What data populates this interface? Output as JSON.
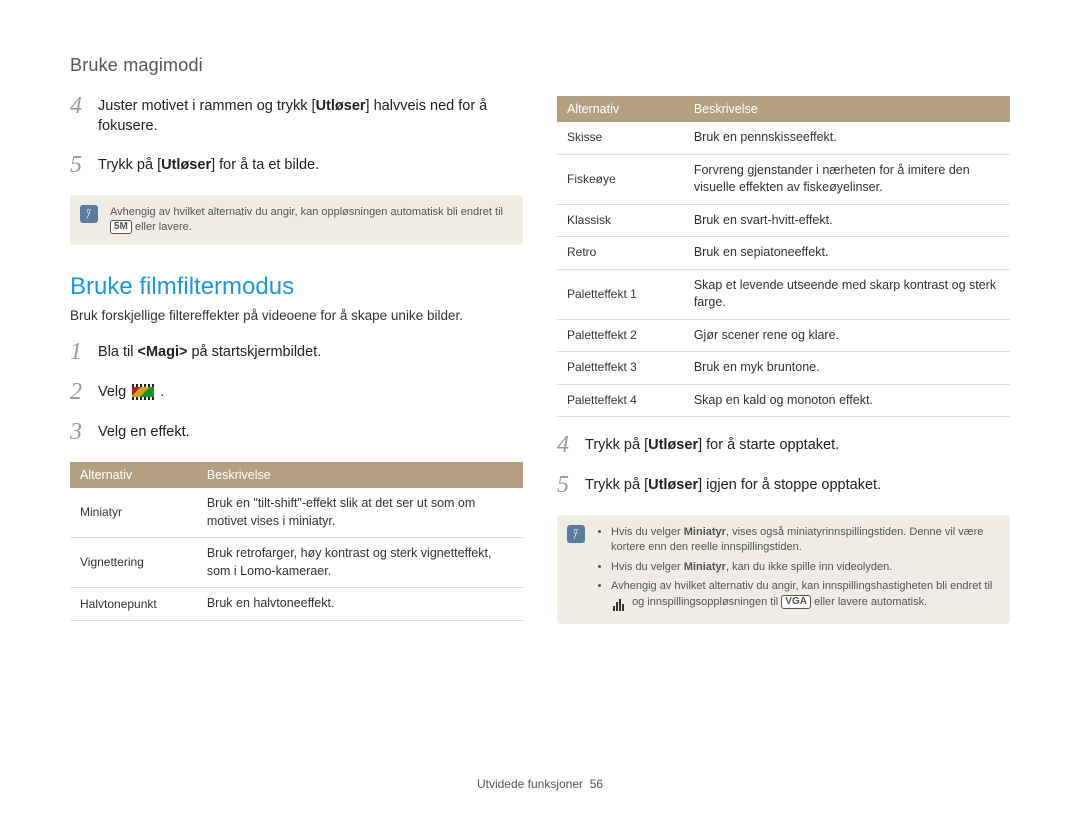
{
  "header": {
    "title": "Bruke magimodi"
  },
  "left": {
    "step4": {
      "num": "4",
      "pre": "Juster motivet i rammen og trykk [",
      "bold": "Utløser",
      "post": "] halvveis ned for å fokusere."
    },
    "step5": {
      "num": "5",
      "pre": "Trykk på [",
      "bold": "Utløser",
      "post": "] for å ta et bilde."
    },
    "note1": {
      "text_pre": "Avhengig av hvilket alternativ du angir, kan oppløsningen automatisk bli endret til ",
      "pill": "5M",
      "text_post": " eller lavere."
    },
    "heading": "Bruke filmfiltermodus",
    "subheading": "Bruk forskjellige filtereffekter på videoene for å skape unike bilder.",
    "step1": {
      "num": "1",
      "pre": "Bla til ",
      "bold": "<Magi>",
      "post": " på startskjermbildet."
    },
    "step2": {
      "num": "2",
      "text": "Velg",
      "post": " ."
    },
    "step3": {
      "num": "3",
      "text": "Velg en effekt."
    },
    "tableHeaders": {
      "opt": "Alternativ",
      "desc": "Beskrivelse"
    },
    "rows": [
      {
        "opt": "Miniatyr",
        "desc": "Bruk en \"tilt-shift\"-effekt slik at det ser ut som om motivet vises i miniatyr."
      },
      {
        "opt": "Vignettering",
        "desc": "Bruk retrofarger, høy kontrast og sterk vignetteffekt, som i Lomo-kameraer."
      },
      {
        "opt": "Halvtonepunkt",
        "desc": "Bruk en halvtoneeffekt."
      }
    ]
  },
  "right": {
    "tableHeaders": {
      "opt": "Alternativ",
      "desc": "Beskrivelse"
    },
    "rows": [
      {
        "opt": "Skisse",
        "desc": "Bruk en pennskisseeffekt."
      },
      {
        "opt": "Fiskeøye",
        "desc": "Forvreng gjenstander i nærheten for å imitere den visuelle effekten av fiskeøyelinser."
      },
      {
        "opt": "Klassisk",
        "desc": "Bruk en svart-hvitt-effekt."
      },
      {
        "opt": "Retro",
        "desc": "Bruk en sepiatoneeffekt."
      },
      {
        "opt": "Paletteffekt 1",
        "desc": "Skap et levende utseende med skarp kontrast og sterk farge."
      },
      {
        "opt": "Paletteffekt 2",
        "desc": "Gjør scener rene og klare."
      },
      {
        "opt": "Paletteffekt 3",
        "desc": "Bruk en myk bruntone."
      },
      {
        "opt": "Paletteffekt 4",
        "desc": "Skap en kald og monoton effekt."
      }
    ],
    "step4": {
      "num": "4",
      "pre": "Trykk på [",
      "bold": "Utløser",
      "post": "] for å starte opptaket."
    },
    "step5": {
      "num": "5",
      "pre": "Trykk på [",
      "bold": "Utløser",
      "post": "] igjen for å stoppe opptaket."
    },
    "note2": {
      "li1_pre": "Hvis du velger ",
      "li1_bold": "Miniatyr",
      "li1_post": ", vises også miniatyrinnspillingstiden. Denne vil være kortere enn den reelle innspillingstiden.",
      "li2_pre": "Hvis du velger ",
      "li2_bold": "Miniatyr",
      "li2_post": ", kan du ikke spille inn videolyden.",
      "li3_pre": "Avhengig av hvilket alternativ du angir, kan innspillingshastigheten bli endret til ",
      "li3_mid": " og innspillingsoppløsningen til ",
      "li3_pill": "VGA",
      "li3_post": " eller lavere automatisk."
    }
  },
  "footer": {
    "label": "Utvidede funksjoner",
    "page": "56"
  }
}
